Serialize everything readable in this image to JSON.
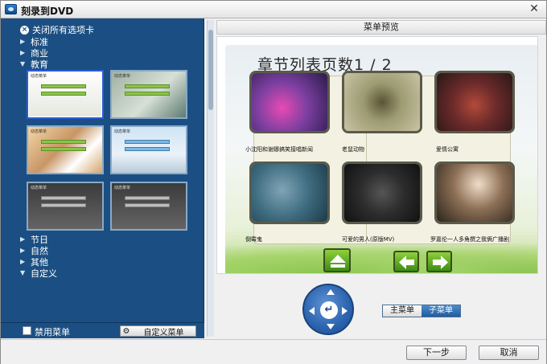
{
  "window": {
    "title": "刻录到DVD",
    "close_glyph": "✕"
  },
  "left_panel": {
    "close_all_label": "关闭所有选项卡",
    "categories": [
      {
        "label": "标准",
        "expanded": false
      },
      {
        "label": "商业",
        "expanded": false
      },
      {
        "label": "教育",
        "expanded": true
      },
      {
        "label": "节日",
        "expanded": false
      },
      {
        "label": "自然",
        "expanded": false
      },
      {
        "label": "其他",
        "expanded": false
      },
      {
        "label": "自定义",
        "expanded": true
      }
    ],
    "disable_menu_label": "禁用菜单",
    "disable_menu_checked": false,
    "custom_menu_label": "自定义菜单"
  },
  "preview": {
    "header": "菜单预览",
    "page_title": "章节列表页数1 / 2",
    "chapters": [
      {
        "caption": "小沈阳和谢娜搞笑接唱新闻"
      },
      {
        "caption": "老鼠动物"
      },
      {
        "caption": "爱情公寓"
      },
      {
        "caption": "倒霉鬼"
      },
      {
        "caption": "可爱的男人(原版MV)"
      },
      {
        "caption": "罗嘉伦一人多角撰之我俩广播剧"
      }
    ],
    "chapter_tag_text": "动态菜单"
  },
  "controls": {
    "enter_glyph": "↵",
    "tab_main": "主菜单",
    "tab_sub": "子菜单",
    "active_tab": "子菜单"
  },
  "footer": {
    "next_label": "下一步",
    "cancel_label": "取消"
  },
  "colors": {
    "panel_bg": "#1b4f83",
    "nav_green": "#3d8c14",
    "selection_blue": "#2a5dd6"
  }
}
